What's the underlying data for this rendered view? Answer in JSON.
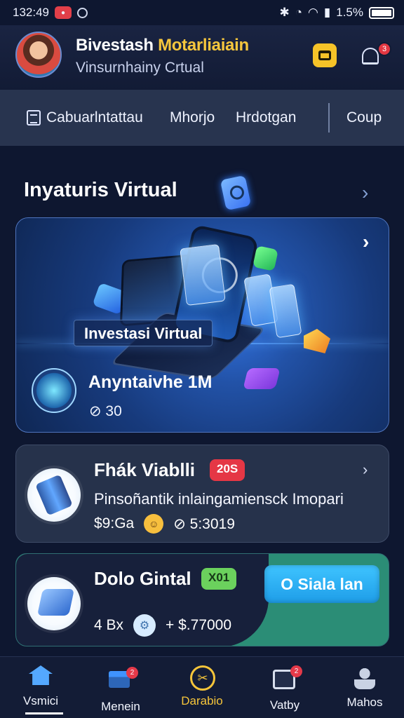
{
  "status_bar": {
    "time": "132:49",
    "battery": "1.5%"
  },
  "header": {
    "title_part1": "Bivestash",
    "title_highlight": "Motarliaiain",
    "subtitle": "Vinsurnhainy Crtual",
    "wallet_icon": "wallet-icon",
    "bell_icon": "bell-icon",
    "notification_count": "3"
  },
  "subnav": {
    "items": [
      {
        "label": "Cabuarlntattau",
        "icon": "document-icon"
      },
      {
        "label": "Mhorjo"
      },
      {
        "label": "Hrdotgan"
      },
      {
        "label": "Coup"
      }
    ]
  },
  "section": {
    "title": "Inyaturis Virtual"
  },
  "hero": {
    "caption": "Investasi Virtual",
    "amount": "Anyntaivhe 1M",
    "meta": "⊘ 30"
  },
  "cards": [
    {
      "title": "Fhák Viablli",
      "tag": "20S",
      "description": "Pinsoñantik inlaingamiensck Imopari",
      "price": "$9:Ga",
      "meta_value": "⊘ 5:3019",
      "icon": "investment-roll-icon",
      "tag_color": "#e53745"
    },
    {
      "title": "Dolo Gintal",
      "tag": "X01",
      "button_label": "O Siala lan",
      "meta_prefix": "4 Bx",
      "meta_value": "+ $.77000",
      "icon": "digital-box-icon",
      "tag_color": "#6bd15d"
    }
  ],
  "bottom_nav": [
    {
      "label": "Vsmici",
      "icon": "home-icon",
      "active": true
    },
    {
      "label": "Menein",
      "icon": "store-icon",
      "badge": "2"
    },
    {
      "label": "Darabio",
      "icon": "tools-icon",
      "accent": "#f6c53a"
    },
    {
      "label": "Vatby",
      "icon": "wallet-icon",
      "badge": "2"
    },
    {
      "label": "Mahos",
      "icon": "user-icon"
    }
  ]
}
